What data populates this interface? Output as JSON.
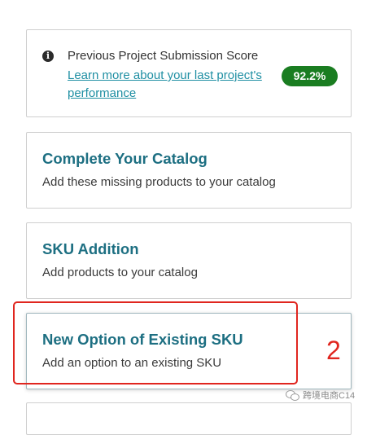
{
  "score_card": {
    "info_icon": "info-circle-icon",
    "title": "Previous Project Submission Score",
    "link_text": "Learn more about your last project's performance",
    "score": "92.2%",
    "score_color": "#1a7d21"
  },
  "cards": [
    {
      "title": "Complete Your Catalog",
      "description": "Add these missing products to your catalog"
    },
    {
      "title": "SKU Addition",
      "description": "Add products to your catalog"
    },
    {
      "title": "New Option of Existing SKU",
      "description": "Add an option to an existing SKU"
    }
  ],
  "annotation": {
    "number": "2",
    "color": "#e0261f"
  },
  "watermark": {
    "icon": "wechat-icon",
    "text": "跨境电商C14"
  },
  "colors": {
    "title_teal": "#1d6f82",
    "link_teal": "#1f8fa3"
  }
}
